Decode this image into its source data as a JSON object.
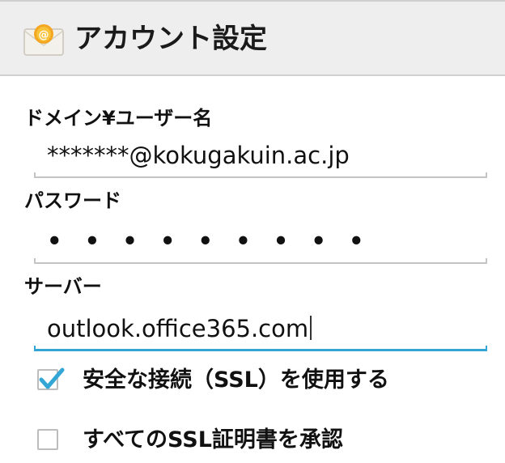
{
  "header": {
    "title": "アカウント設定",
    "icon": "email-app-icon"
  },
  "form": {
    "username_label": "ドメイン¥ユーザー名",
    "username_value": "*******@kokugakuin.ac.jp",
    "password_label": "パスワード",
    "password_value": "• • • • • • • • •",
    "server_label": "サーバー",
    "server_value": "outlook.office365.com"
  },
  "options": [
    {
      "label": "安全な接続（SSL）を使用する",
      "checked": true
    },
    {
      "label": "すべてのSSL証明書を承認",
      "checked": false
    }
  ],
  "colors": {
    "accent": "#33a6d6",
    "header_bg": "#eeeeee"
  }
}
